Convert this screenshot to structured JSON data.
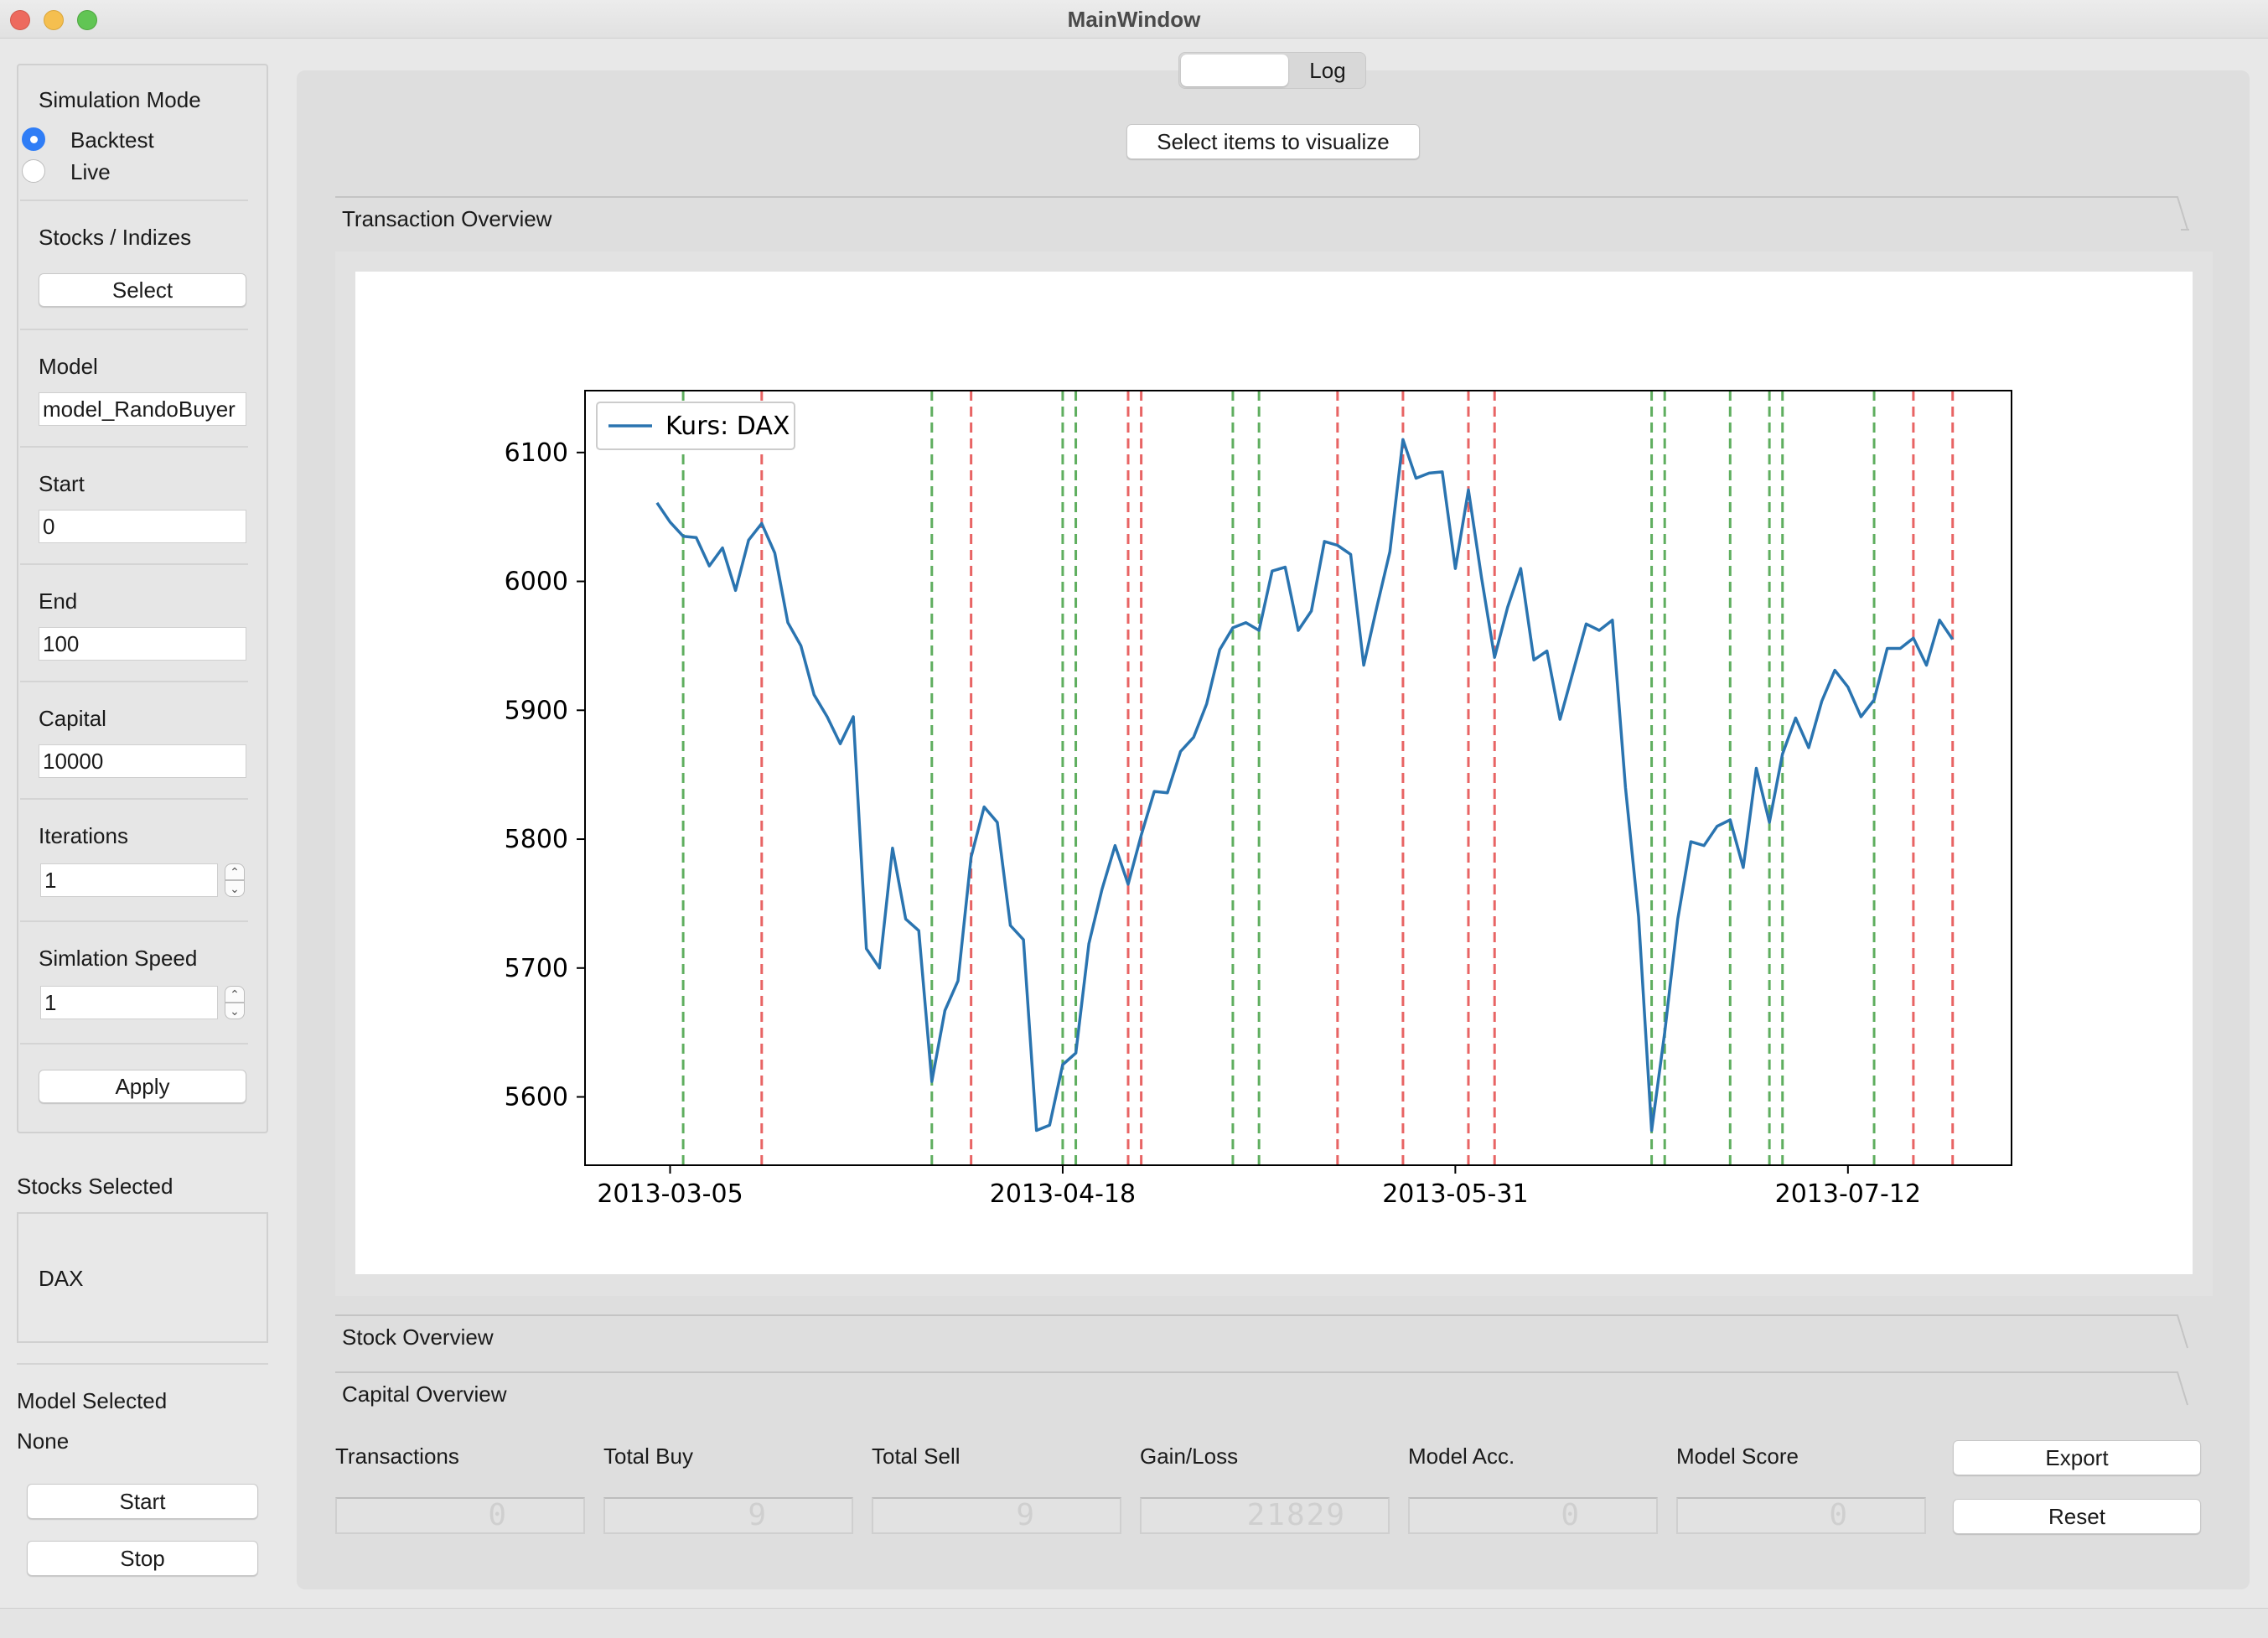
{
  "window": {
    "title": "MainWindow"
  },
  "sidebar": {
    "simulation_mode": {
      "label": "Simulation Mode",
      "options": [
        "Backtest",
        "Live"
      ],
      "selected": "Backtest"
    },
    "stocks": {
      "label": "Stocks / Indizes",
      "button": "Select"
    },
    "model": {
      "label": "Model",
      "value": "model_RandoBuyer"
    },
    "start": {
      "label": "Start",
      "value": "0"
    },
    "end": {
      "label": "End",
      "value": "100"
    },
    "capital": {
      "label": "Capital",
      "value": "10000"
    },
    "iterations": {
      "label": "Iterations",
      "value": "1"
    },
    "speed": {
      "label": "Simlation Speed",
      "value": "1"
    },
    "apply_button": "Apply",
    "stocks_selected": {
      "label": "Stocks Selected",
      "items": [
        "DAX"
      ]
    },
    "model_selected": {
      "label": "Model Selected",
      "value": "None"
    },
    "start_button": "Start",
    "stop_button": "Stop"
  },
  "tabs": {
    "active_label": "",
    "log_label": "Log"
  },
  "visualize_button": "Select items to visualize",
  "sections": {
    "transaction": "Transaction Overview",
    "stock": "Stock Overview",
    "capital": "Capital Overview"
  },
  "stats": {
    "transactions": {
      "label": "Transactions",
      "value": "0"
    },
    "total_buy": {
      "label": "Total Buy",
      "value": "9"
    },
    "total_sell": {
      "label": "Total Sell",
      "value": "9"
    },
    "gain_loss": {
      "label": "Gain/Loss",
      "value": "21829"
    },
    "model_acc": {
      "label": "Model Acc.",
      "value": "0"
    },
    "model_score": {
      "label": "Model Score",
      "value": "0"
    }
  },
  "export_button": "Export",
  "reset_button": "Reset",
  "colors": {
    "line": "#2a74b0",
    "buy": "#5fae5f",
    "sell": "#e86464",
    "accent": "#2f7df6"
  },
  "chart_data": {
    "type": "line",
    "series": [
      {
        "name": "Kurs: DAX",
        "values": [
          6061,
          6046,
          6035,
          6034,
          6012,
          6026,
          5993,
          6032,
          6045,
          6022,
          5968,
          5950,
          5912,
          5895,
          5874,
          5895,
          5715,
          5700,
          5793,
          5738,
          5729,
          5612,
          5667,
          5690,
          5786,
          5825,
          5813,
          5733,
          5722,
          5574,
          5578,
          5625,
          5634,
          5719,
          5761,
          5795,
          5765,
          5803,
          5837,
          5836,
          5868,
          5879,
          5905,
          5947,
          5964,
          5968,
          5962,
          6008,
          6011,
          5962,
          5977,
          6031,
          6028,
          6021,
          5935,
          5980,
          6023,
          6110,
          6080,
          6084,
          6085,
          6010,
          6071,
          6003,
          5941,
          5980,
          6010,
          5939,
          5946,
          5893,
          5930,
          5967,
          5962,
          5970,
          5840,
          5740,
          5574,
          5650,
          5738,
          5798,
          5795,
          5810,
          5815,
          5778,
          5855,
          5813,
          5866,
          5894,
          5871,
          5907,
          5931,
          5918,
          5895,
          5908,
          5948,
          5948,
          5956,
          5935,
          5970,
          5955
        ]
      }
    ],
    "x_start": "2013-03-05",
    "xticks": [
      "2013-03-05",
      "2013-04-18",
      "2013-05-31",
      "2013-07-12"
    ],
    "xtick_index": [
      1,
      31,
      61,
      91
    ],
    "yticks": [
      5600,
      5700,
      5800,
      5900,
      6000,
      6100
    ],
    "ylim": [
      5547,
      6148
    ],
    "xlim": [
      -5.5,
      103.5
    ],
    "buy_markers_index": [
      2,
      21,
      31,
      32,
      44,
      46,
      76,
      77,
      82,
      85,
      86,
      93
    ],
    "sell_markers_index": [
      8,
      24,
      36,
      37,
      52,
      57,
      62,
      64,
      96,
      99
    ],
    "legend_position": "upper left",
    "grid": false
  }
}
